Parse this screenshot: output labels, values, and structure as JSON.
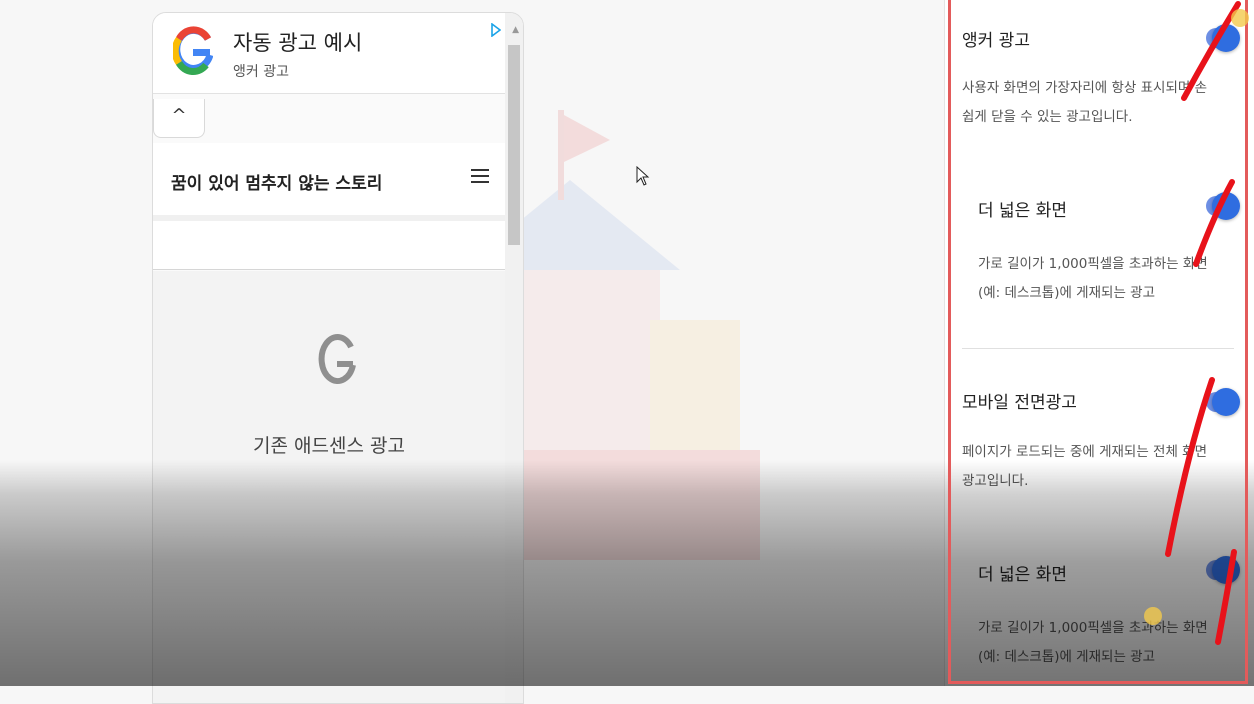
{
  "preview": {
    "ad_title": "자동 광고 예시",
    "ad_subtitle": "앵커 광고",
    "collapse_glyph": "^",
    "site_title": "꿈이 있어 멈추지 않는 스토리",
    "legacy_ad_label": "기존 애드센스 광고"
  },
  "settings": {
    "anchor": {
      "title": "앵커 광고",
      "desc_line1": "사용자 화면의 가장자리에 항상 표시되며 손",
      "desc_line2": "쉽게 닫을 수 있는 광고입니다.",
      "enabled": true
    },
    "anchor_wide": {
      "title": "더 넓은 화면",
      "desc_line1": "가로 길이가 1,000픽셀을 초과하는 화면",
      "desc_line2": "(예: 데스크톱)에 게재되는 광고",
      "enabled": true
    },
    "vignette": {
      "title": "모바일 전면광고",
      "desc_line1": "페이지가 로드되는 중에 게재되는 전체 화면",
      "desc_line2": "광고입니다.",
      "enabled": true
    },
    "vignette_wide": {
      "title": "더 넓은 화면",
      "desc_line1": "가로 길이가 1,000픽셀을 초과하는 화면",
      "desc_line2": "(예: 데스크톱)에 게재되는 광고",
      "enabled": true
    }
  },
  "colors": {
    "toggle_on": "#2f6de0",
    "highlight": "#e35b5b",
    "annotation": "#e8121a"
  },
  "icons": [
    "google-g-icon",
    "adchoices-icon",
    "chevron-up-icon",
    "hamburger-menu-icon",
    "mouse-pointer-icon"
  ]
}
